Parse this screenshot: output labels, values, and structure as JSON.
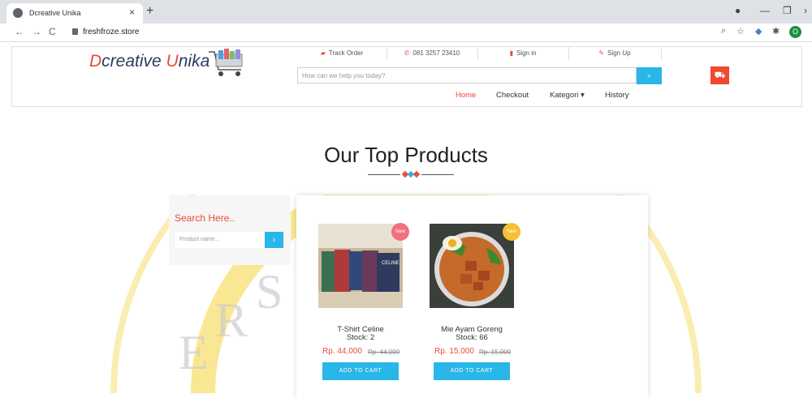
{
  "browser": {
    "tab_title": "Dcreative Unika",
    "tab_close": "×",
    "new_tab": "+",
    "url": "freshfroze.store",
    "back": "←",
    "forward": "→",
    "reload": "C",
    "minimize": "—",
    "maximize": "❐",
    "close": "✕",
    "zoom_icon": "🔍",
    "star_icon": "☆",
    "ext_icon": "✱",
    "profile_initial": "O"
  },
  "header": {
    "logo_first_accent": "D",
    "logo_first": "creative ",
    "logo_second_accent": "U",
    "logo_second": "nika",
    "topbar": [
      {
        "icon": "▰",
        "label": "Track Order"
      },
      {
        "icon": "✆",
        "label": "081 3257 23410"
      },
      {
        "icon": "🔒",
        "label": "Sign in"
      },
      {
        "icon": "✎",
        "label": "Sign Up"
      }
    ],
    "search_placeholder": "How can we help you today?",
    "search_icon": "🔍",
    "cart_icon": "🛒",
    "nav": [
      "Home",
      "Checkout",
      "Kategori ▾",
      "History"
    ]
  },
  "section": {
    "title": "Our Top Products"
  },
  "sidebar": {
    "title": "Search Here..",
    "input_placeholder": "Product name...",
    "button_icon": "›"
  },
  "products": [
    {
      "name": "T-Shirt Celine",
      "stock": "Stock: 2",
      "price": "Rp. 44,000",
      "old_price": "Rp. 44,000",
      "badge": "New",
      "badge_color": "#f2707f",
      "button": "ADD TO CART"
    },
    {
      "name": "Mie Ayam Goreng",
      "stock": "Stock: 66",
      "price": "Rp. 15,000",
      "old_price": "Rp. 15,000",
      "badge": "New",
      "badge_color": "#f7c035",
      "button": "ADD TO CART"
    }
  ],
  "colors": {
    "accent": "#e74c3c",
    "primary": "#29b6e8",
    "cart": "#f0492f",
    "watermark": "#f5d33b"
  }
}
